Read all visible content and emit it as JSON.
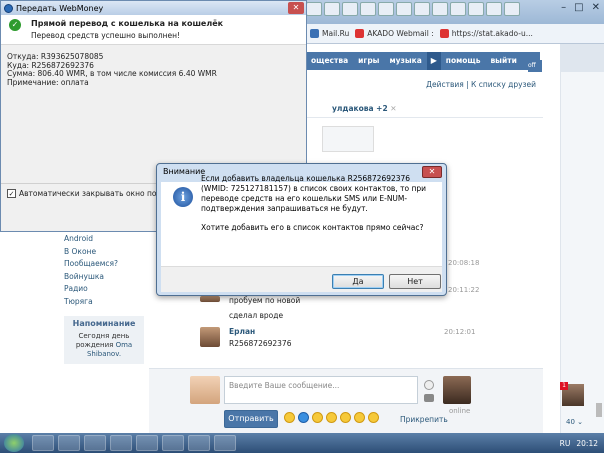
{
  "bookmarks": [
    "Mail.Ru",
    "AKADO Webmail :",
    "https://stat.akado-u..."
  ],
  "vk_nav": [
    "ощества",
    "игры",
    "музыка",
    "помощь",
    "выйти"
  ],
  "vk_nav_more": "off",
  "subbar": "Действия | К списку друзей",
  "chat_name": "улдакова +2",
  "time_top": "20:08:18",
  "left_menu": [
    "Android",
    "В Оконе",
    "Пообщаемся?",
    "Войнушка",
    "Радио",
    "Тюряга"
  ],
  "reminder": {
    "title": "Напоминание",
    "line1": "Сегодня",
    "line1b": "день",
    "line2": "рождения",
    "name": "Oma",
    "line3": "Shibanov."
  },
  "msg_times": [
    "20:08:18",
    "20:11:22",
    "20:12:01"
  ],
  "msgs": {
    "m1": "пробуем по новой",
    "m2": "сделал вроде",
    "sender": "Ерлан",
    "m3": "R256872692376"
  },
  "composer": {
    "placeholder": "Введите Ваше сообщение...",
    "send": "Отправить",
    "attach": "Прикрепить",
    "online": "online"
  },
  "right_count": "40",
  "wm": {
    "title": "Передать WebMoney",
    "header_title": "Прямой перевод с кошелька на кошелёк",
    "header_sub": "Перевод средств успешно выполнен!",
    "from": "Откуда: R393625078085",
    "to": "Куда: R256872692376",
    "sum": "Сумма: 806.40 WMR, в том числе комиссия 6.40 WMR",
    "note": "Примечание: оплата",
    "auto_close": "Автоматически закрывать окно по завершени"
  },
  "dialog": {
    "title": "Внимание",
    "text": "Если добавить владельца кошелька R256872692376 (WMID: 725127181157) в список своих контактов, то при переводе средств на его кошельки SMS или E-NUM-подтверждения запрашиваться не будут.",
    "question": "Хотите добавить его в список контактов прямо сейчас?",
    "yes": "Да",
    "no": "Нет"
  },
  "taskbar": {
    "lang": "RU",
    "time": "20:12"
  }
}
